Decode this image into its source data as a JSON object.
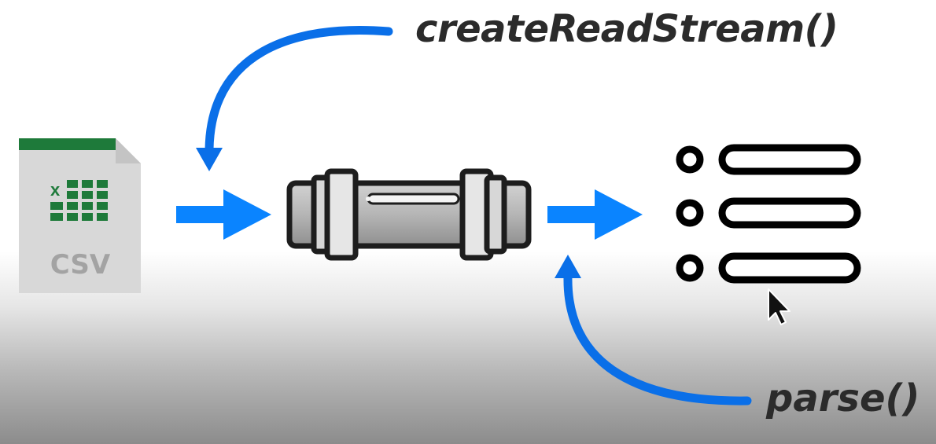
{
  "labels": {
    "read_stream": "createReadStream()",
    "parse": "parse()"
  },
  "file_icon": {
    "text": "CSV",
    "badge_letter": "x",
    "icon": "excel-csv-file-icon"
  },
  "icons": {
    "pipe": "pipe-icon",
    "list": "list-icon",
    "cursor": "mouse-pointer-icon"
  },
  "colors": {
    "arrow_blue": "#0a84ff",
    "curve_blue": "#0a6fe8",
    "excel_green": "#1e7a3a",
    "file_gray": "#d9d9d9",
    "text_dark": "#2b2b2b"
  }
}
